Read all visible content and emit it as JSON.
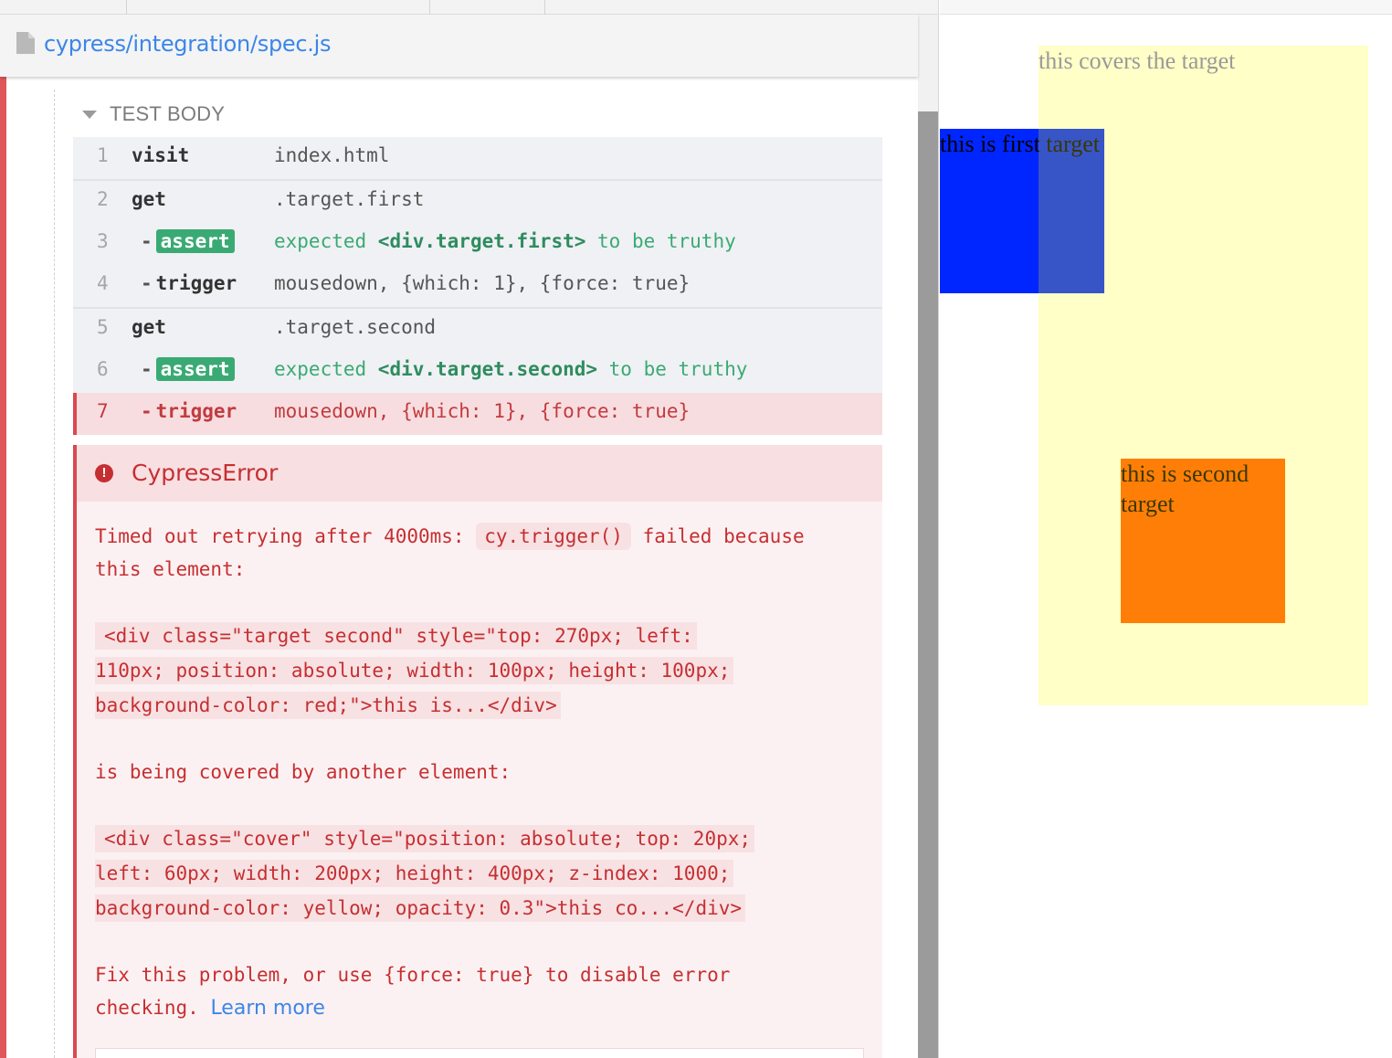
{
  "header": {
    "file_path": "cypress/integration/spec.js",
    "file_icon": "file-icon"
  },
  "test_body": {
    "label": "TEST BODY",
    "caret_icon": "caret-down-icon"
  },
  "commands": [
    {
      "num": "1",
      "name": "visit",
      "message": "index.html"
    },
    {
      "num": "2",
      "name": "get",
      "message": ".target.first"
    },
    {
      "num": "3",
      "dash": "-",
      "name": "assert",
      "message_pre": "expected ",
      "message_bold": "<div.target.first>",
      "message_post": " to be truthy"
    },
    {
      "num": "4",
      "dash": "-",
      "name": "trigger",
      "message": "mousedown, {which: 1}, {force: true}"
    },
    {
      "num": "5",
      "name": "get",
      "message": ".target.second"
    },
    {
      "num": "6",
      "dash": "-",
      "name": "assert",
      "message_pre": "expected ",
      "message_bold": "<div.target.second>",
      "message_post": " to be truthy"
    },
    {
      "num": "7",
      "dash": "-",
      "name": "trigger",
      "message": "mousedown, {which: 1}, {force: true}"
    }
  ],
  "error": {
    "icon": "error-icon",
    "title": "CypressError",
    "line1_pre": "Timed out retrying after 4000ms: ",
    "line1_code": "cy.trigger()",
    "line1_post": " failed because",
    "line2": "this element:",
    "element_code": [
      "<div class=\"target second\" style=\"top: 270px; left: ",
      "110px; position: absolute; width: 100px; height: 100px;",
      "background-color: red;\">this is...</div>"
    ],
    "covered_text": "is being covered by another element:",
    "cover_code": [
      "<div class=\"cover\" style=\"position: absolute; top: 20px;",
      "left: 60px; width: 200px; height: 400px; z-index: 1000;",
      "background-color: yellow; opacity: 0.3\">this co...</div>"
    ],
    "fix_line1": "Fix this problem, or use {force: true} to disable error",
    "fix_line2": "checking. ",
    "learn_more": "Learn more"
  },
  "aut": {
    "cover_text": "this covers the target",
    "first_target_text": "this is first target",
    "second_target_text": "this is second target",
    "colors": {
      "first_target": "#0026ff",
      "second_target": "#ff5a0a",
      "cover": "#ffff00"
    }
  },
  "colors": {
    "accent_blue": "#3b86e8",
    "pass_green": "#3aaa74",
    "fail_red": "#c62f31"
  }
}
